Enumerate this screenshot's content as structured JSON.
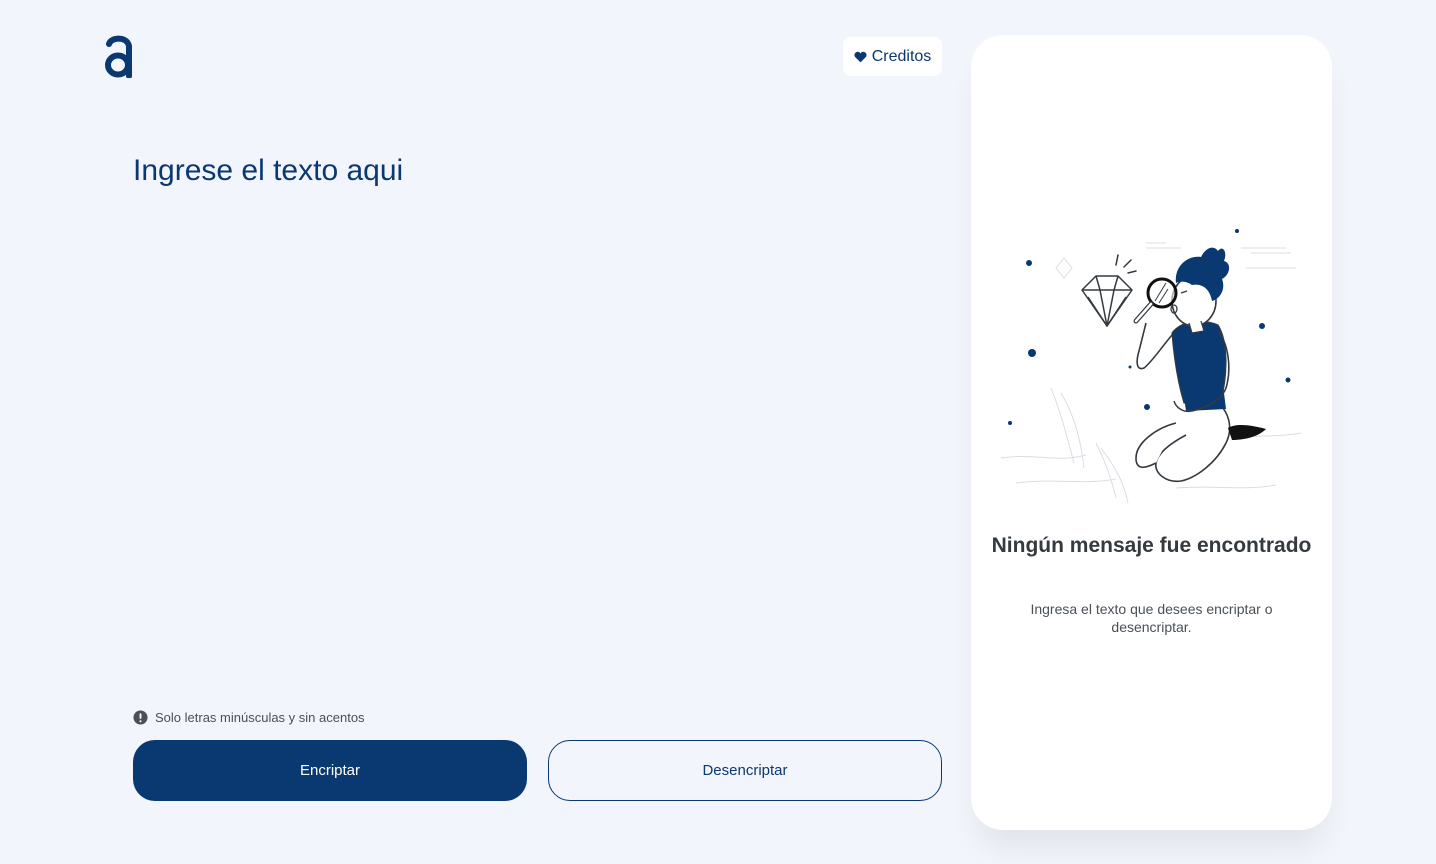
{
  "brand": {
    "logo_icon": "alura-a-logo-icon",
    "primary_color": "#0A3871",
    "background_color": "#F3F5FC"
  },
  "header": {
    "credits_label": "Creditos",
    "credits_icon": "heart-icon"
  },
  "editor": {
    "placeholder": "Ingrese el texto aqui",
    "value": ""
  },
  "hint": {
    "icon": "exclamation-circle-icon",
    "text": "Solo letras minúsculas y sin acentos"
  },
  "actions": {
    "encrypt_label": "Encriptar",
    "decrypt_label": "Desencriptar"
  },
  "output": {
    "illustration": "person-with-magnifying-glass-illustration",
    "title": "Ningún mensaje fue encontrado",
    "subtitle": "Ingresa el texto que desees encriptar o desencriptar."
  }
}
